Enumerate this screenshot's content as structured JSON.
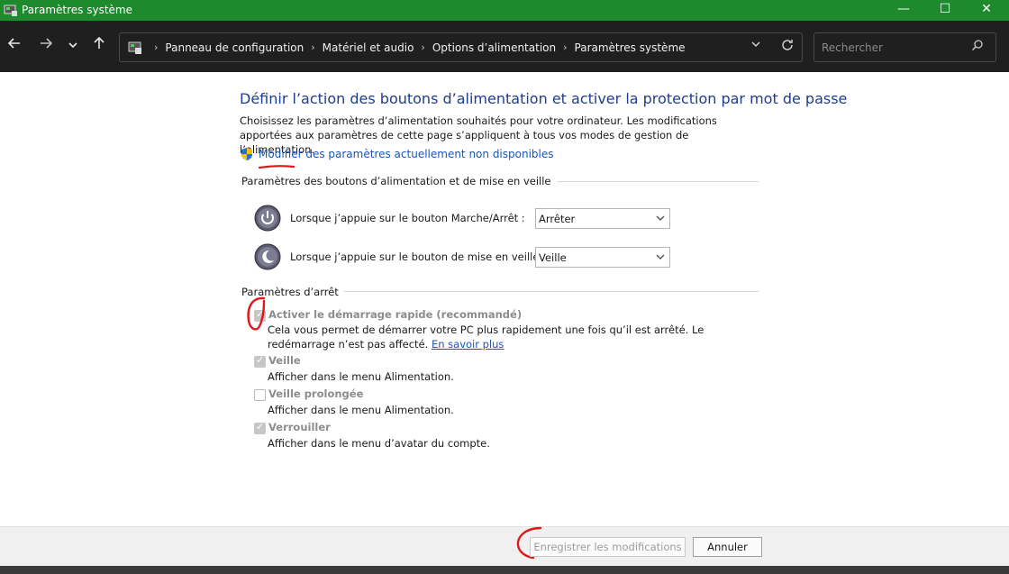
{
  "window": {
    "title": "Paramètres système",
    "controls": {
      "minimize": "—",
      "maximize": "☐",
      "close": "✕"
    }
  },
  "nav": {
    "back_icon": "arrow-left",
    "forward_icon": "arrow-right",
    "recent_icon": "chevron-down",
    "up_icon": "arrow-up",
    "breadcrumbs": [
      "Panneau de configuration",
      "Matériel et audio",
      "Options d’alimentation",
      "Paramètres système"
    ],
    "search_placeholder": "Rechercher"
  },
  "content": {
    "heading": "Définir l’action des boutons d’alimentation et activer la protection par mot de passe",
    "description": "Choisissez les paramètres d’alimentation souhaités pour votre ordinateur. Les modifications apportées aux paramètres de cette page s’appliquent à tous vos modes de gestion de l’alimentation.",
    "modify_link": "Modifier des paramètres actuellement non disponibles",
    "power_section": {
      "title": "Paramètres des boutons d’alimentation et de mise en veille",
      "rows": [
        {
          "label": "Lorsque j’appuie sur le bouton Marche/Arrêt :",
          "value": "Arrêter"
        },
        {
          "label": "Lorsque j’appuie sur le bouton de mise en veille :",
          "value": "Veille"
        }
      ]
    },
    "shutdown_section": {
      "title": "Paramètres d’arrêt",
      "options": [
        {
          "title": "Activer le démarrage rapide (recommandé)",
          "desc": "Cela vous permet de démarrer votre PC plus rapidement une fois qu’il est arrêté. Le redémarrage n’est pas affecté.",
          "link": "En savoir plus",
          "checked": true
        },
        {
          "title": "Veille",
          "desc": "Afficher dans le menu Alimentation.",
          "checked": true
        },
        {
          "title": "Veille prolongée",
          "desc": "Afficher dans le menu Alimentation.",
          "checked": false
        },
        {
          "title": "Verrouiller",
          "desc": "Afficher dans le menu d’avatar du compte.",
          "checked": true
        }
      ]
    }
  },
  "footer": {
    "save_label": "Enregistrer les modifications",
    "cancel_label": "Annuler"
  },
  "colors": {
    "titlebar": "#1d8a2e",
    "heading": "#1e3d8f",
    "link": "#1a56b8",
    "annotation": "#e01818"
  }
}
